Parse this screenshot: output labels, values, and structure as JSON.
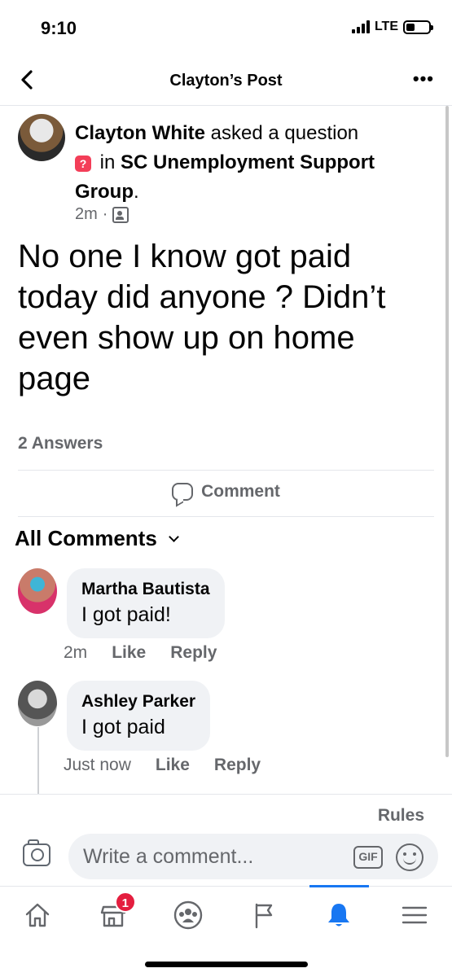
{
  "status_bar": {
    "time": "9:10",
    "network": "LTE",
    "battery_percent": 40
  },
  "header": {
    "title": "Clayton’s Post",
    "more": "•••"
  },
  "post": {
    "author": "Clayton White",
    "action": "asked a question",
    "in_text": "in",
    "group": "SC Unemployment Support Group",
    "group_suffix": ".",
    "badge": "?",
    "time": "2m",
    "separator": "·",
    "body": "No one I know got paid today did anyone ? Didn’t even show up on home page",
    "answers_count": "2 Answers"
  },
  "actions": {
    "comment_label": "Comment"
  },
  "comments_section": {
    "filter_label": "All Comments",
    "comments": [
      {
        "name": "Martha Bautista",
        "text": "I got paid!",
        "time": "2m",
        "like": "Like",
        "reply": "Reply"
      },
      {
        "name": "Ashley Parker",
        "text": "I got paid",
        "time": "Just now",
        "like": "Like",
        "reply": "Reply"
      }
    ]
  },
  "composer": {
    "rules": "Rules",
    "placeholder": "Write a comment...",
    "gif": "GIF"
  },
  "tab_bar": {
    "tabs": [
      {
        "name": "home",
        "icon": "home-icon"
      },
      {
        "name": "marketplace",
        "icon": "store-icon",
        "badge": "1"
      },
      {
        "name": "groups",
        "icon": "groups-icon"
      },
      {
        "name": "pages",
        "icon": "flag-icon"
      },
      {
        "name": "notifications",
        "icon": "bell-icon",
        "active": true
      },
      {
        "name": "menu",
        "icon": "menu-icon"
      }
    ]
  },
  "colors": {
    "accent": "#1877f2",
    "badge_red": "#e41e3f",
    "question_pink": "#f33e58",
    "secondary_text": "#65676b"
  }
}
